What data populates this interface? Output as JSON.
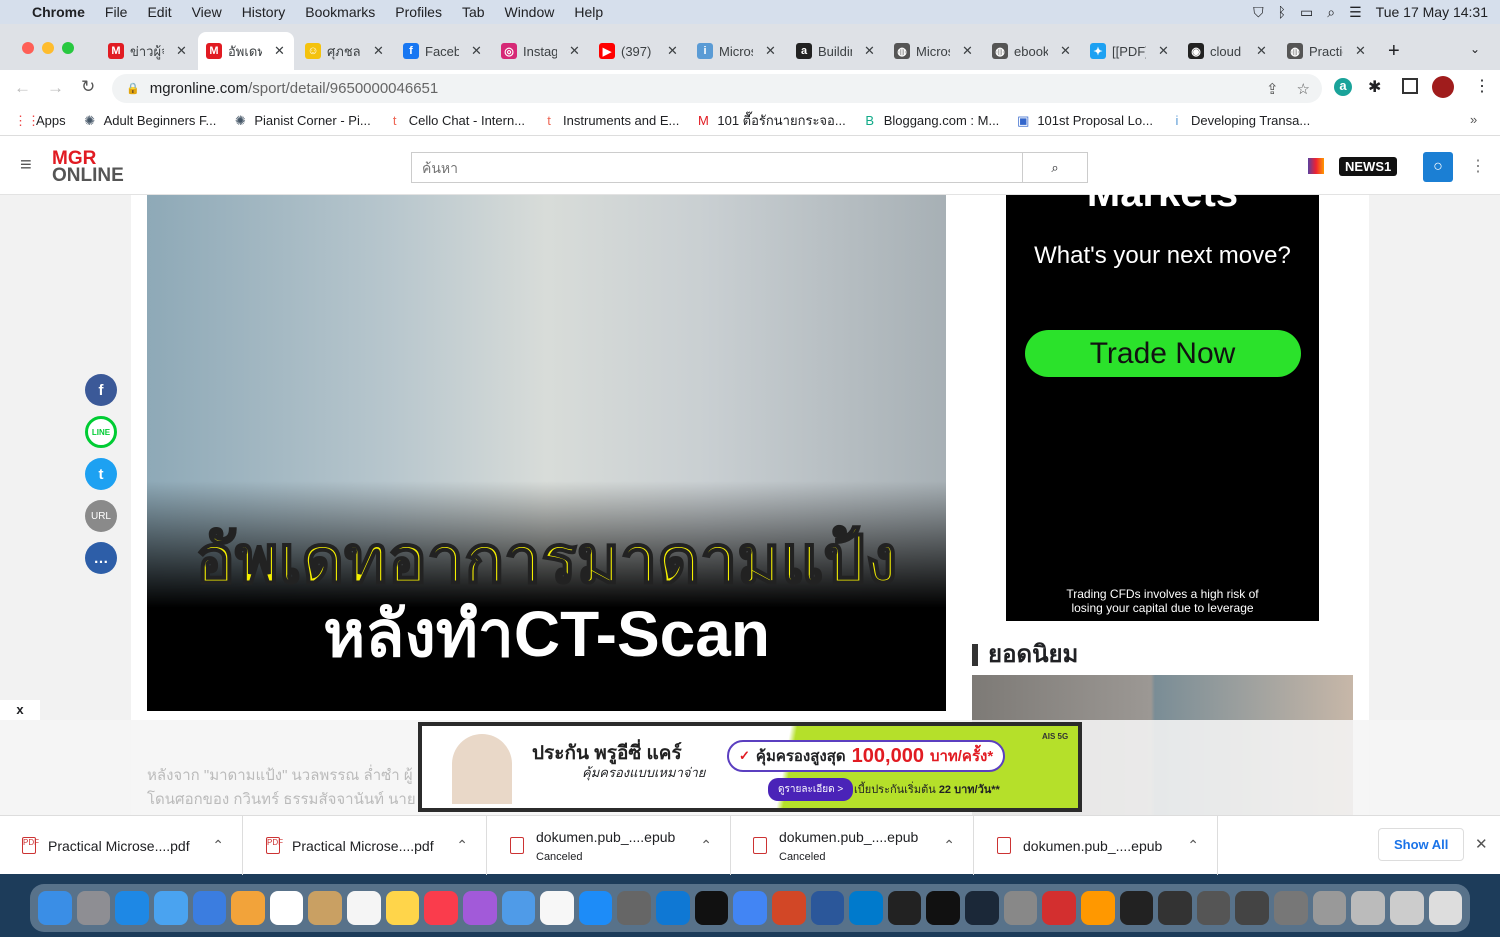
{
  "menubar": {
    "app": "Chrome",
    "items": [
      "File",
      "Edit",
      "View",
      "History",
      "Bookmarks",
      "Profiles",
      "Tab",
      "Window",
      "Help"
    ],
    "clock": "Tue 17 May  14:31"
  },
  "tabs": [
    {
      "label": "ข่าวผู้จัดการ",
      "icon": "M",
      "color": "#e11b22"
    },
    {
      "label": "อัพเดทอาการ",
      "icon": "M",
      "color": "#e11b22",
      "active": true
    },
    {
      "label": "ศุภชลาศัย",
      "icon": "☺",
      "color": "#f4c20d"
    },
    {
      "label": "Facebook",
      "icon": "f",
      "color": "#1877f2"
    },
    {
      "label": "Instagram",
      "icon": "◎",
      "color": "#d62976"
    },
    {
      "label": "(397)",
      "icon": "▶",
      "color": "#f00"
    },
    {
      "label": "Microservices",
      "icon": "i",
      "color": "#5a9bd5"
    },
    {
      "label": "Building",
      "icon": "a",
      "color": "#222"
    },
    {
      "label": "Microsoft",
      "icon": "◍",
      "color": "#555"
    },
    {
      "label": "ebook",
      "icon": "◍",
      "color": "#555"
    },
    {
      "label": "[[PDF]]",
      "icon": "✦",
      "color": "#1da1f2"
    },
    {
      "label": "cloud",
      "icon": "◉",
      "color": "#222"
    },
    {
      "label": "Practical",
      "icon": "◍",
      "color": "#555"
    }
  ],
  "url": {
    "domain": "mgronline.com",
    "path": "/sport/detail/9650000046651"
  },
  "bookmarks": [
    {
      "label": "Apps",
      "icon": "⋮⋮"
    },
    {
      "label": "Adult Beginners F...",
      "icon": "✺"
    },
    {
      "label": "Pianist Corner - Pi...",
      "icon": "✺"
    },
    {
      "label": "Cello Chat - Intern...",
      "icon": "t"
    },
    {
      "label": "Instruments and E...",
      "icon": "t"
    },
    {
      "label": "101 ตื๊อรักนายกระจอ...",
      "icon": "M"
    },
    {
      "label": "Bloggang.com : M...",
      "icon": "B"
    },
    {
      "label": "101st Proposal Lo...",
      "icon": "▣"
    },
    {
      "label": "Developing Transa...",
      "icon": "i"
    }
  ],
  "site": {
    "logo_top": "MGR",
    "logo_bottom": "ONLINE",
    "search_placeholder": "ค้นหา",
    "news1": "NEWS1"
  },
  "hero": {
    "line1": "อัพเดทอาการมาดามแป้ง",
    "line2": "หลังทำCT-Scan"
  },
  "ad": {
    "top": "Markets",
    "headline": "What's your next move?",
    "cta": "Trade Now",
    "disclaimer": "Trading CFDs involves a high risk of losing your capital due to leverage"
  },
  "popular_heading": "ยอดนิยม",
  "share": [
    "f",
    "LINE",
    "t",
    "URL",
    "…"
  ],
  "article": {
    "p1": "หลังจาก \"มาดามแป้ง\" นวลพรรณ ล่ำซำ ผู้",
    "p2": "โดนศอกของ กวินทร์ ธรรมสัจจานันท์ นาย"
  },
  "banner": {
    "brand": "ประกัน พรูอีซี่ แคร์",
    "sub": "คุ้มครองแบบเหมาจ่าย",
    "cover": "คุ้มครองสูงสุด",
    "amount": "100,000",
    "unit": "บาท/ครั้ง*",
    "button": "ดูรายละเอียด >",
    "premium": "เบี้ยประกันเริ่มต้น",
    "price": "22 บาท/วัน**",
    "partner": "AIS 5G"
  },
  "close_overlay": "x",
  "downloads": [
    {
      "name": "Practical Microse....pdf",
      "status": ""
    },
    {
      "name": "Practical Microse....pdf",
      "status": ""
    },
    {
      "name": "dokumen.pub_....epub",
      "status": "Canceled"
    },
    {
      "name": "dokumen.pub_....epub",
      "status": "Canceled"
    },
    {
      "name": "dokumen.pub_....epub",
      "status": ""
    }
  ],
  "show_all": "Show All"
}
